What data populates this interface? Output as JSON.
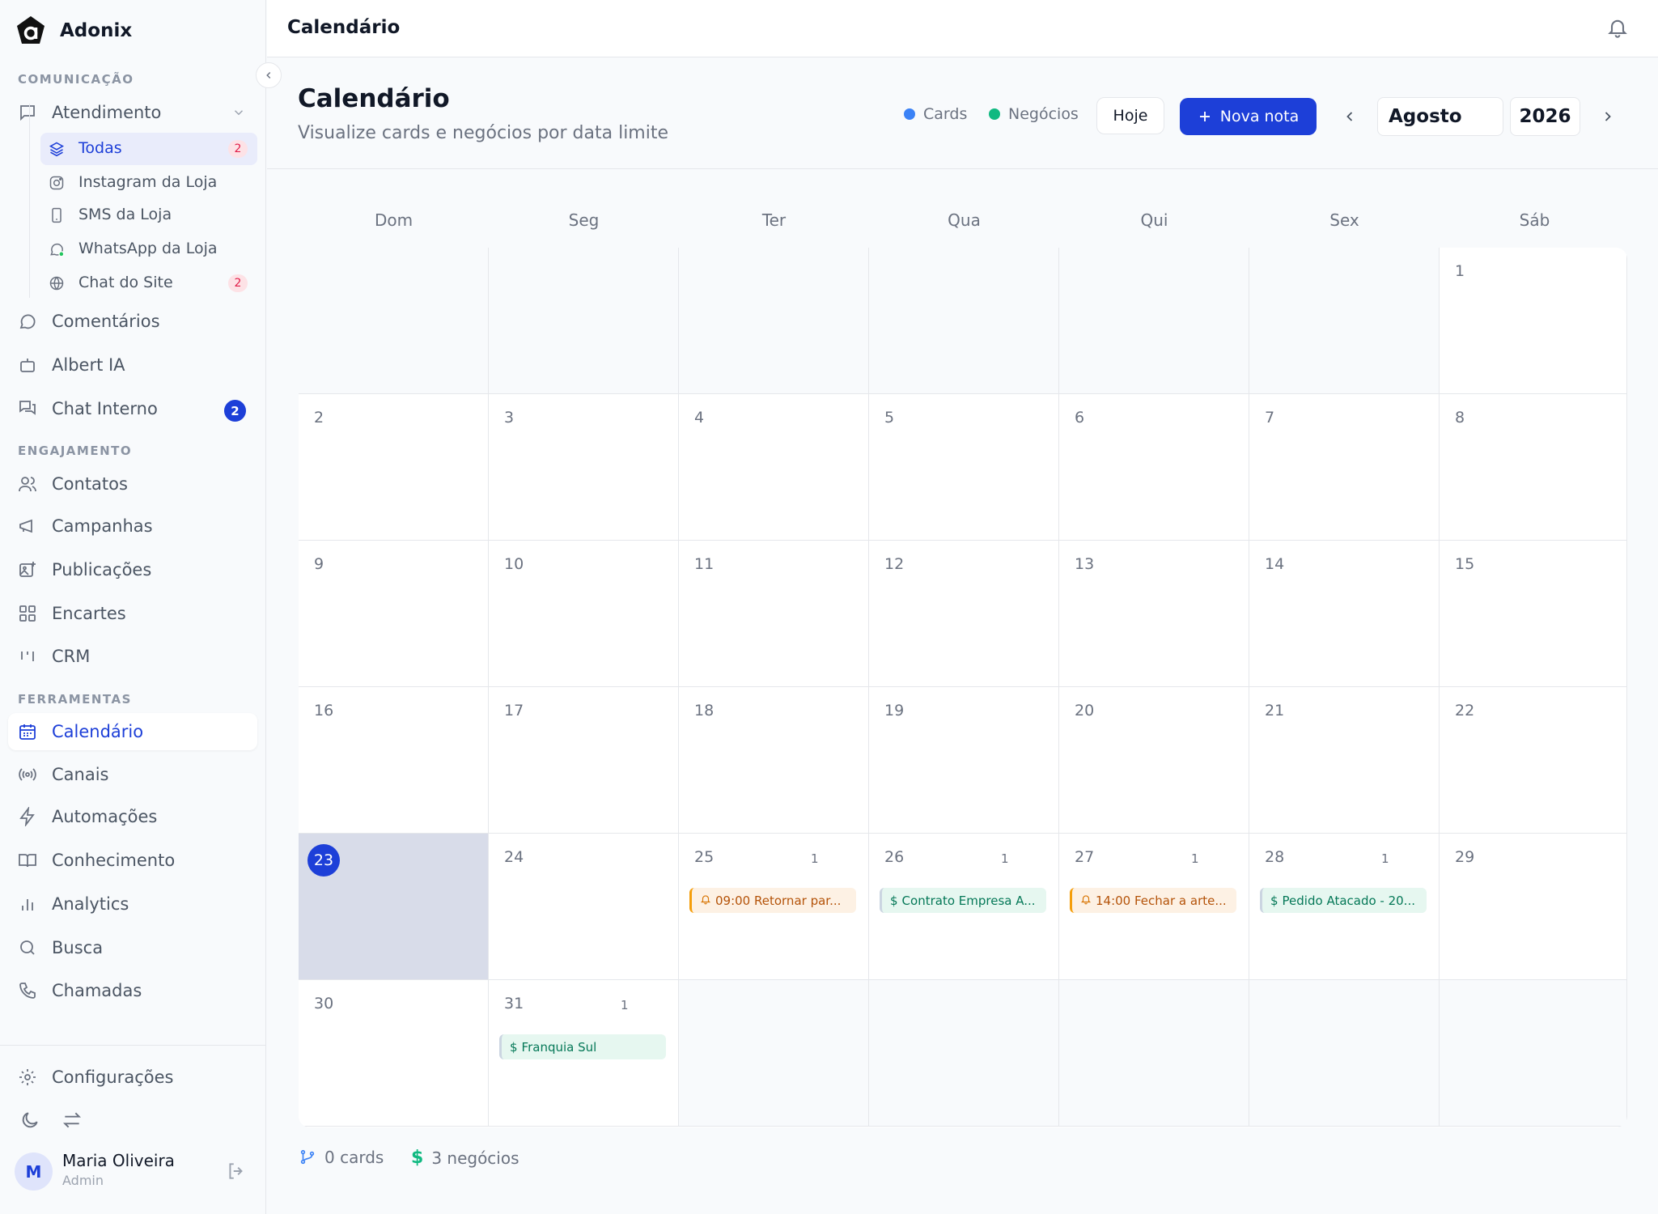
{
  "brand": {
    "name": "Adonix"
  },
  "sidebar": {
    "sections": {
      "comunicacao": "COMUNICAÇÃO",
      "engajamento": "ENGAJAMENTO",
      "ferramentas": "FERRAMENTAS"
    },
    "atendimento": {
      "label": "Atendimento",
      "subitems": [
        {
          "label": "Todas",
          "badge": "2",
          "icon": "layers-icon"
        },
        {
          "label": "Instagram da Loja",
          "icon": "instagram-icon"
        },
        {
          "label": "SMS da Loja",
          "icon": "phone-icon"
        },
        {
          "label": "WhatsApp da Loja",
          "icon": "whatsapp-icon"
        },
        {
          "label": "Chat do Site",
          "badge": "2",
          "icon": "globe-icon"
        }
      ]
    },
    "comentarios": "Comentários",
    "albert": "Albert IA",
    "chat_interno": {
      "label": "Chat Interno",
      "badge": "2"
    },
    "contatos": "Contatos",
    "campanhas": "Campanhas",
    "publicacoes": "Publicações",
    "encartes": "Encartes",
    "crm": "CRM",
    "calendario": "Calendário",
    "canais": "Canais",
    "automacoes": "Automações",
    "conhecimento": "Conhecimento",
    "analytics": "Analytics",
    "busca": "Busca",
    "chamadas": "Chamadas",
    "configuracoes": "Configurações"
  },
  "user": {
    "initial": "M",
    "name": "Maria Oliveira",
    "role": "Admin"
  },
  "topbar": {
    "title": "Calendário"
  },
  "header": {
    "title": "Calendário",
    "subtitle": "Visualize cards e negócios por data limite",
    "legend": {
      "cards": "Cards",
      "negocios": "Negócios"
    },
    "today_button": "Hoje",
    "new_note_button": "Nova nota",
    "month": "Agosto",
    "year": "2026"
  },
  "colors": {
    "accent": "#1d3fd8",
    "cards_dot": "#3b82f6",
    "negocios_dot": "#10b981"
  },
  "calendar": {
    "weekdays": [
      "Dom",
      "Seg",
      "Ter",
      "Qua",
      "Qui",
      "Sex",
      "Sáb"
    ],
    "today": "23",
    "weeks": [
      [
        null,
        null,
        null,
        null,
        null,
        null,
        {
          "day": "1"
        }
      ],
      [
        {
          "day": "2"
        },
        {
          "day": "3"
        },
        {
          "day": "4"
        },
        {
          "day": "5"
        },
        {
          "day": "6"
        },
        {
          "day": "7"
        },
        {
          "day": "8"
        }
      ],
      [
        {
          "day": "9"
        },
        {
          "day": "10"
        },
        {
          "day": "11"
        },
        {
          "day": "12"
        },
        {
          "day": "13"
        },
        {
          "day": "14"
        },
        {
          "day": "15"
        }
      ],
      [
        {
          "day": "16"
        },
        {
          "day": "17"
        },
        {
          "day": "18"
        },
        {
          "day": "19"
        },
        {
          "day": "20"
        },
        {
          "day": "21"
        },
        {
          "day": "22"
        }
      ],
      [
        {
          "day": "23"
        },
        {
          "day": "24"
        },
        {
          "day": "25",
          "count": "1",
          "event": {
            "type": "card",
            "text": "09:00 Retornar par..."
          }
        },
        {
          "day": "26",
          "count": "1",
          "event": {
            "type": "deal",
            "text": "Contrato Empresa A..."
          }
        },
        {
          "day": "27",
          "count": "1",
          "event": {
            "type": "card",
            "text": "14:00 Fechar a arte..."
          }
        },
        {
          "day": "28",
          "count": "1",
          "event": {
            "type": "deal",
            "text": "Pedido Atacado - 20..."
          }
        },
        {
          "day": "29"
        }
      ],
      [
        {
          "day": "30"
        },
        {
          "day": "31",
          "count": "1",
          "event": {
            "type": "deal",
            "text": "Franquia Sul"
          }
        },
        null,
        null,
        null,
        null,
        null
      ]
    ]
  },
  "footer": {
    "cards": "0 cards",
    "negocios": "3 negócios"
  }
}
